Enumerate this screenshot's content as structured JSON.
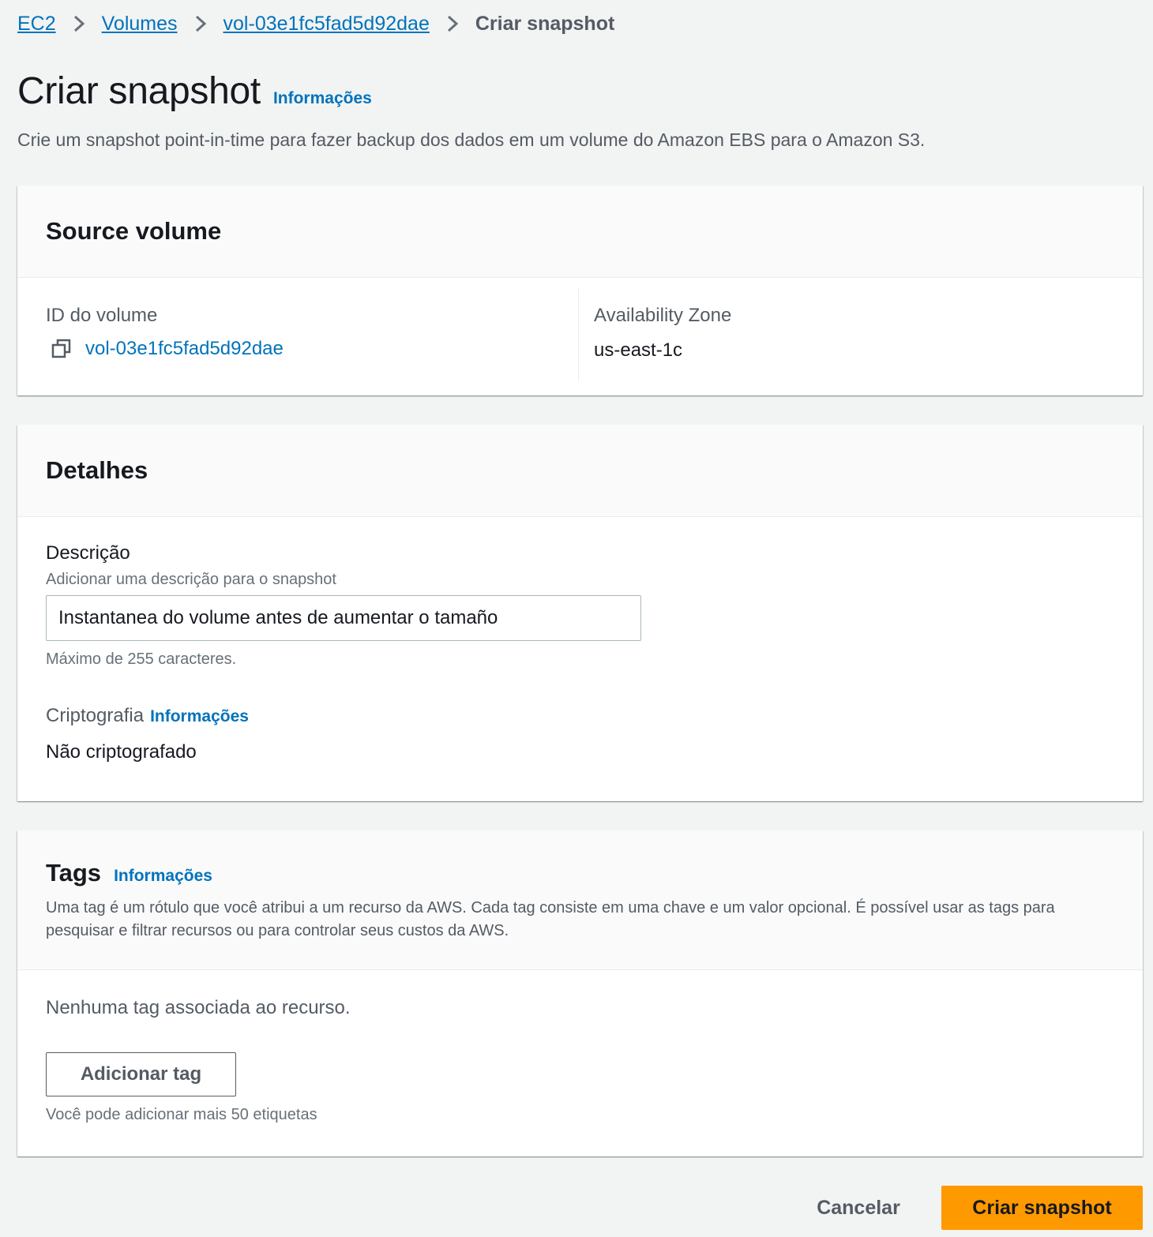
{
  "breadcrumb": {
    "items": [
      {
        "label": "EC2"
      },
      {
        "label": "Volumes"
      },
      {
        "label": "vol-03e1fc5fad5d92dae"
      },
      {
        "label": "Criar snapshot"
      }
    ],
    "separator_icon": "chevron-right-icon"
  },
  "header": {
    "title": "Criar snapshot",
    "info_label": "Informações",
    "description": "Crie um snapshot point-in-time para fazer backup dos dados em um volume do Amazon EBS para o Amazon S3."
  },
  "source_volume": {
    "title": "Source volume",
    "volume_id_label": "ID do volume",
    "volume_id": "vol-03e1fc5fad5d92dae",
    "copy_icon": "copy-icon",
    "az_label": "Availability Zone",
    "az_value": "us-east-1c"
  },
  "details": {
    "title": "Detalhes",
    "description_label": "Descrição",
    "description_help": "Adicionar uma descrição para o snapshot",
    "description_value": "Instantanea do volume antes de aumentar o tamaño",
    "description_hint": "Máximo de 255 caracteres.",
    "encryption_label": "Criptografia",
    "encryption_info": "Informações",
    "encryption_value": "Não criptografado"
  },
  "tags": {
    "title": "Tags",
    "info_label": "Informações",
    "description": "Uma tag é um rótulo que você atribui a um recurso da AWS. Cada tag consiste em uma chave e um valor opcional. É possível usar as tags para pesquisar e filtrar recursos ou para controlar seus custos da AWS.",
    "empty_text": "Nenhuma tag associada ao recurso.",
    "add_button": "Adicionar tag",
    "add_hint": "Você pode adicionar mais 50 etiquetas"
  },
  "actions": {
    "cancel_label": "Cancelar",
    "submit_label": "Criar snapshot"
  },
  "colors": {
    "link": "#0073bb",
    "primary_button": "#ff9900",
    "background": "#f2f3f3"
  }
}
